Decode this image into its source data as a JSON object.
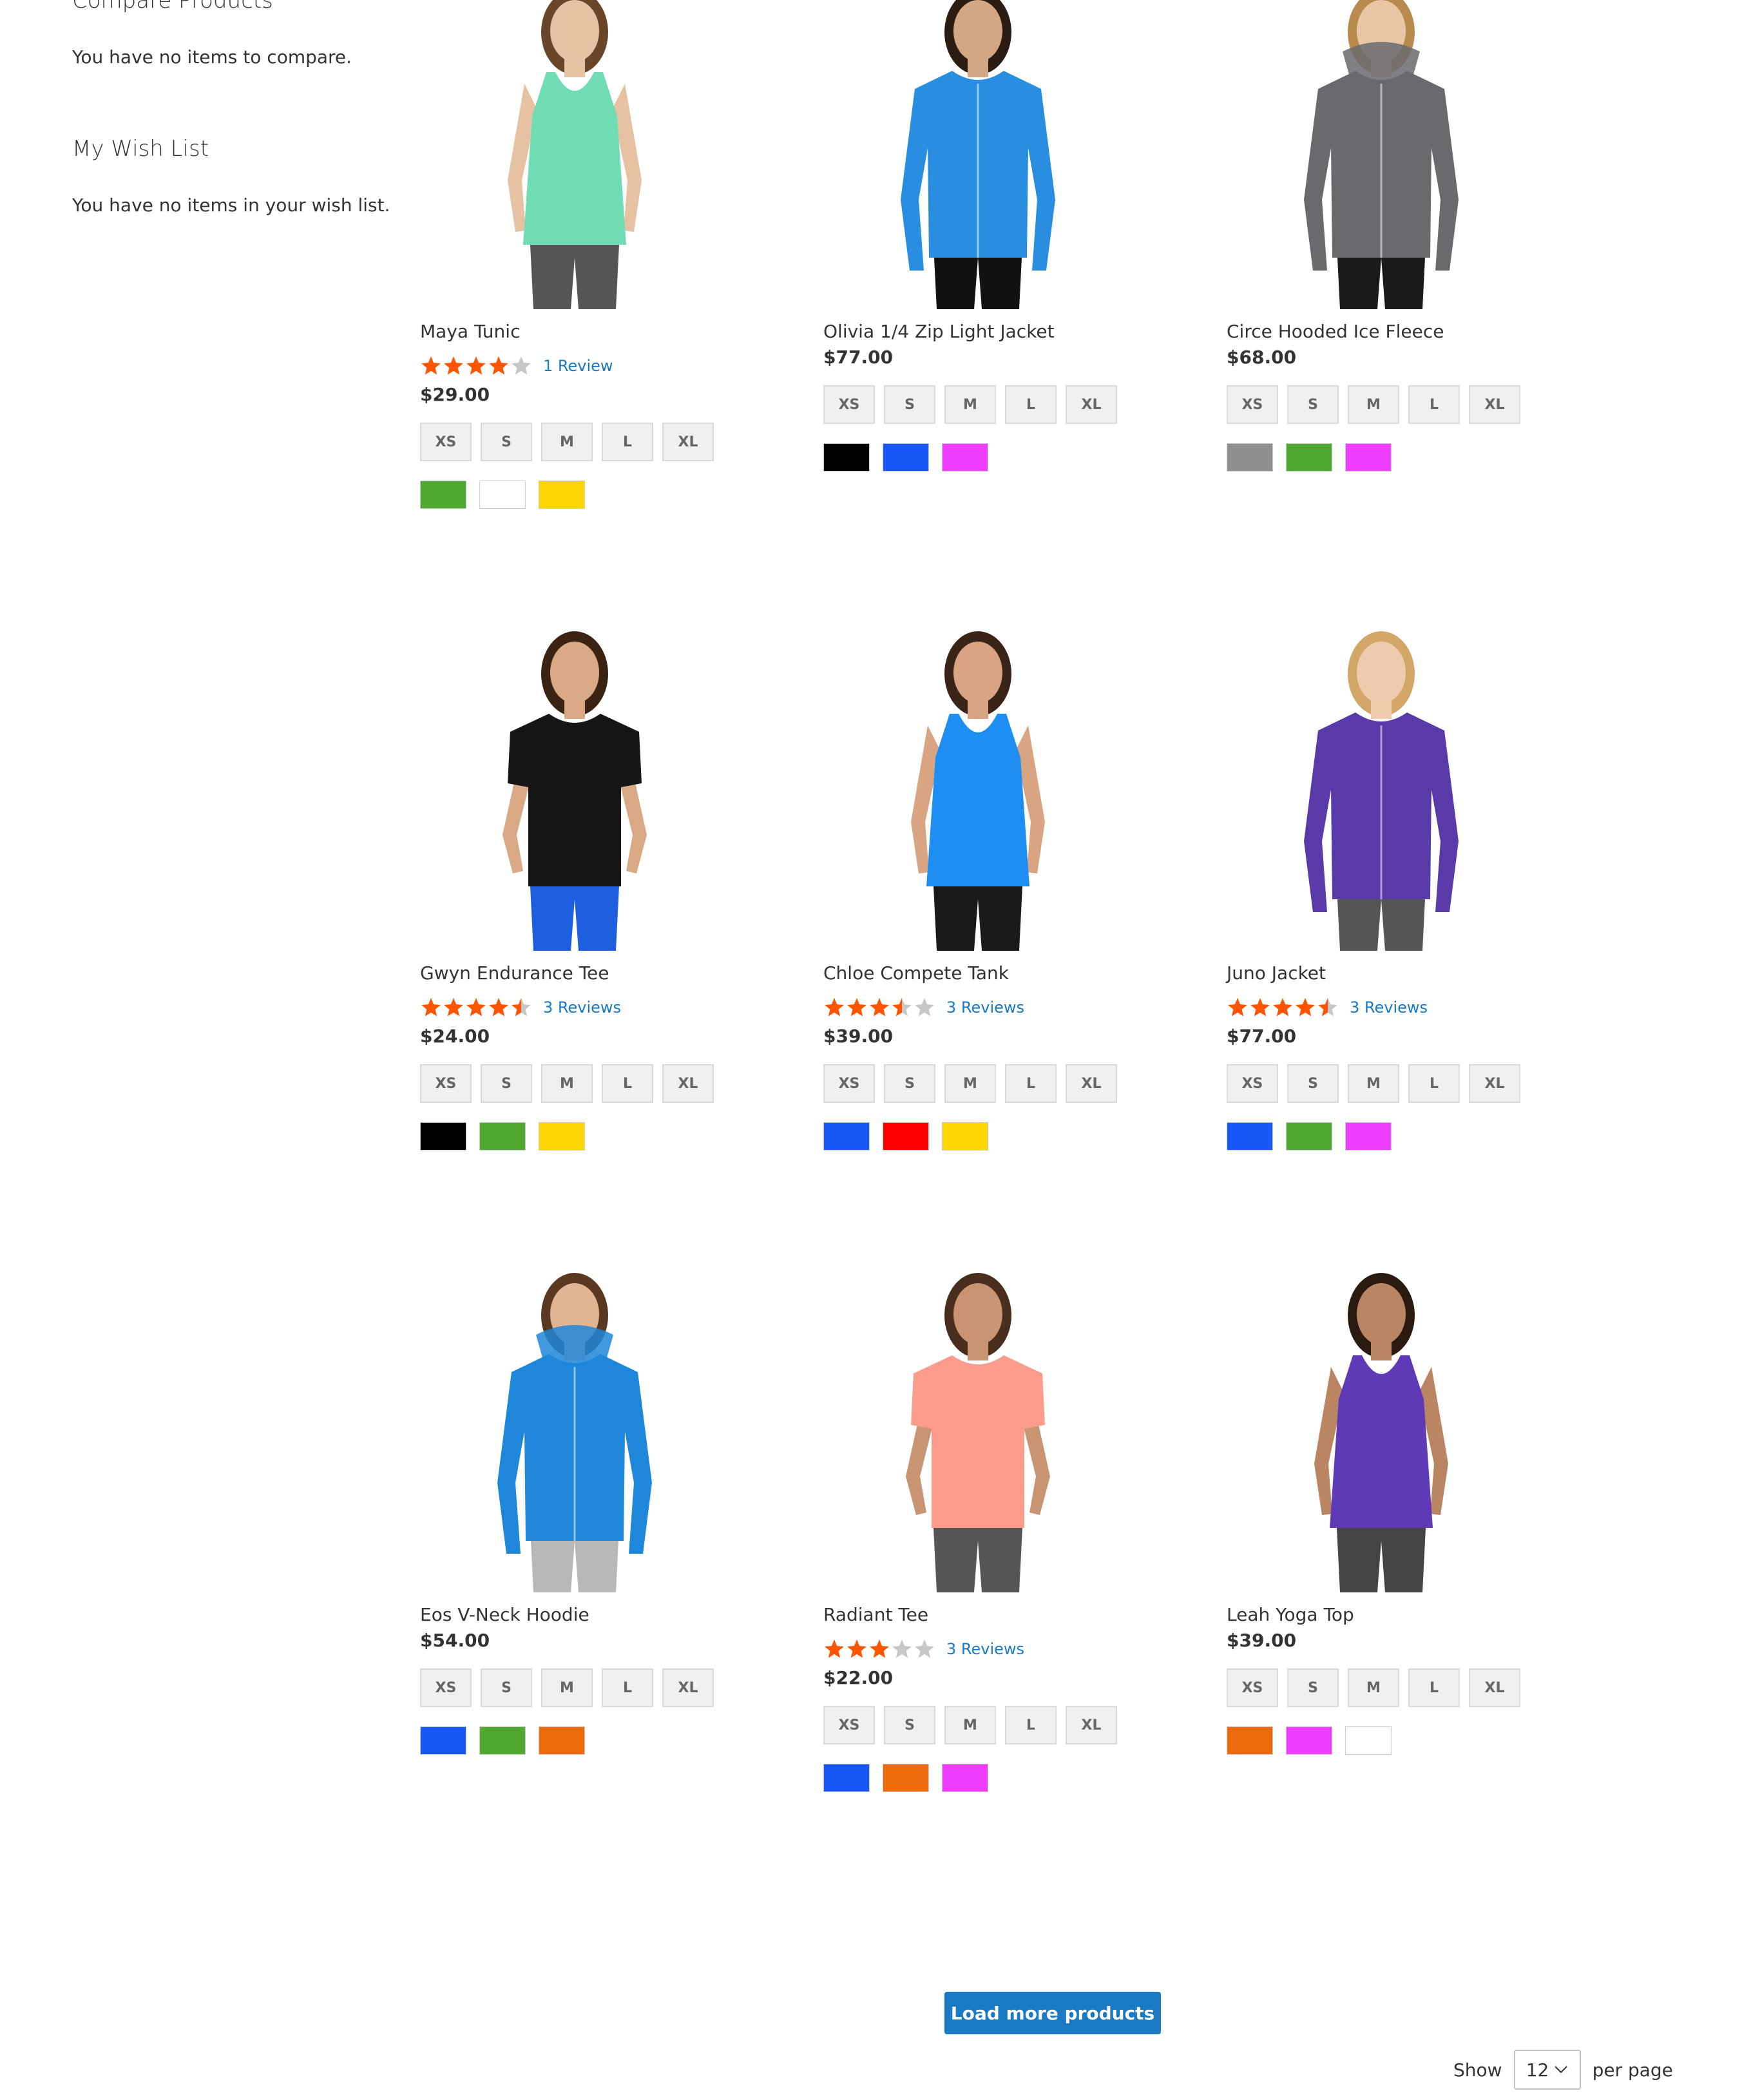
{
  "sidebar": {
    "compare_title": "Compare Products",
    "compare_empty": "You have no items to compare.",
    "wishlist_title": "My Wish List",
    "wishlist_empty": "You have no items in your wish list."
  },
  "products": [
    {
      "name": "Maya Tunic",
      "rating": 4,
      "reviews": "1  Review",
      "price": "$29.00",
      "garment": "tank",
      "garment_color": "#6fdcb3",
      "bottom_color": "#555555",
      "skin": "#e7c2a2",
      "hair": "#6b4528",
      "colors": [
        "#50a82e",
        "#ffffff",
        "#ffd500"
      ]
    },
    {
      "name": "Olivia 1/4 Zip Light Jacket",
      "rating": null,
      "reviews": "",
      "price": "$77.00",
      "garment": "jacket",
      "garment_color": "#2a8ee0",
      "bottom_color": "#111111",
      "skin": "#d4a784",
      "hair": "#2b1c14",
      "colors": [
        "#000000",
        "#1857f7",
        "#ef3dff"
      ]
    },
    {
      "name": "Circe Hooded Ice Fleece",
      "rating": null,
      "reviews": "",
      "price": "$68.00",
      "garment": "hoodie",
      "garment_color": "#6a6a6e",
      "bottom_color": "#1a1a1a",
      "skin": "#e8c6a6",
      "hair": "#b88a4e",
      "colors": [
        "#8f8f8f",
        "#50a82e",
        "#ef3dff"
      ]
    },
    {
      "name": "Gwyn Endurance Tee",
      "rating": 4.5,
      "reviews": "3  Reviews",
      "price": "$24.00",
      "garment": "tee",
      "garment_color": "#151515",
      "bottom_color": "#1e5fe0",
      "skin": "#d9a985",
      "hair": "#3b2314",
      "colors": [
        "#000000",
        "#50a82e",
        "#ffd500"
      ]
    },
    {
      "name": "Chloe Compete Tank",
      "rating": 3.5,
      "reviews": "3  Reviews",
      "price": "$39.00",
      "garment": "tank",
      "garment_color": "#1e8ef2",
      "bottom_color": "#1a1a1a",
      "skin": "#d8a482",
      "hair": "#3a2417",
      "colors": [
        "#1857f7",
        "#ff0000",
        "#ffd500"
      ]
    },
    {
      "name": "Juno Jacket",
      "rating": 4.5,
      "reviews": "3  Reviews",
      "price": "$77.00",
      "garment": "jacket",
      "garment_color": "#5a3aa8",
      "bottom_color": "#555555",
      "skin": "#efcbad",
      "hair": "#d2a667",
      "colors": [
        "#1857f7",
        "#50a82e",
        "#ef3dff"
      ]
    },
    {
      "name": "Eos V-Neck Hoodie",
      "rating": null,
      "reviews": "",
      "price": "$54.00",
      "garment": "hoodie",
      "garment_color": "#1f87d9",
      "bottom_color": "#b8b8b8",
      "skin": "#e1b494",
      "hair": "#5b3820",
      "colors": [
        "#1857f7",
        "#50a82e",
        "#eb6b0c"
      ]
    },
    {
      "name": "Radiant Tee",
      "rating": 3,
      "reviews": "3  Reviews",
      "price": "$22.00",
      "garment": "tee",
      "garment_color": "#fb9c8d",
      "bottom_color": "#555555",
      "skin": "#c99472",
      "hair": "#4a2e1d",
      "colors": [
        "#1857f7",
        "#eb6b0c",
        "#ef3dff"
      ]
    },
    {
      "name": "Leah Yoga Top",
      "rating": null,
      "reviews": "",
      "price": "$39.00",
      "garment": "tank",
      "garment_color": "#5f3ab6",
      "bottom_color": "#444444",
      "skin": "#b98563",
      "hair": "#2a1a10",
      "colors": [
        "#eb6b0c",
        "#ef3dff",
        "#ffffff"
      ]
    }
  ],
  "sizes": [
    "XS",
    "S",
    "M",
    "L",
    "XL"
  ],
  "star_color": "#ff5501",
  "star_empty_color": "#c7c7c7",
  "load_more_label": "Load more products",
  "pager": {
    "show_label": "Show",
    "limit_value": "12",
    "per_page_label": "per page"
  }
}
